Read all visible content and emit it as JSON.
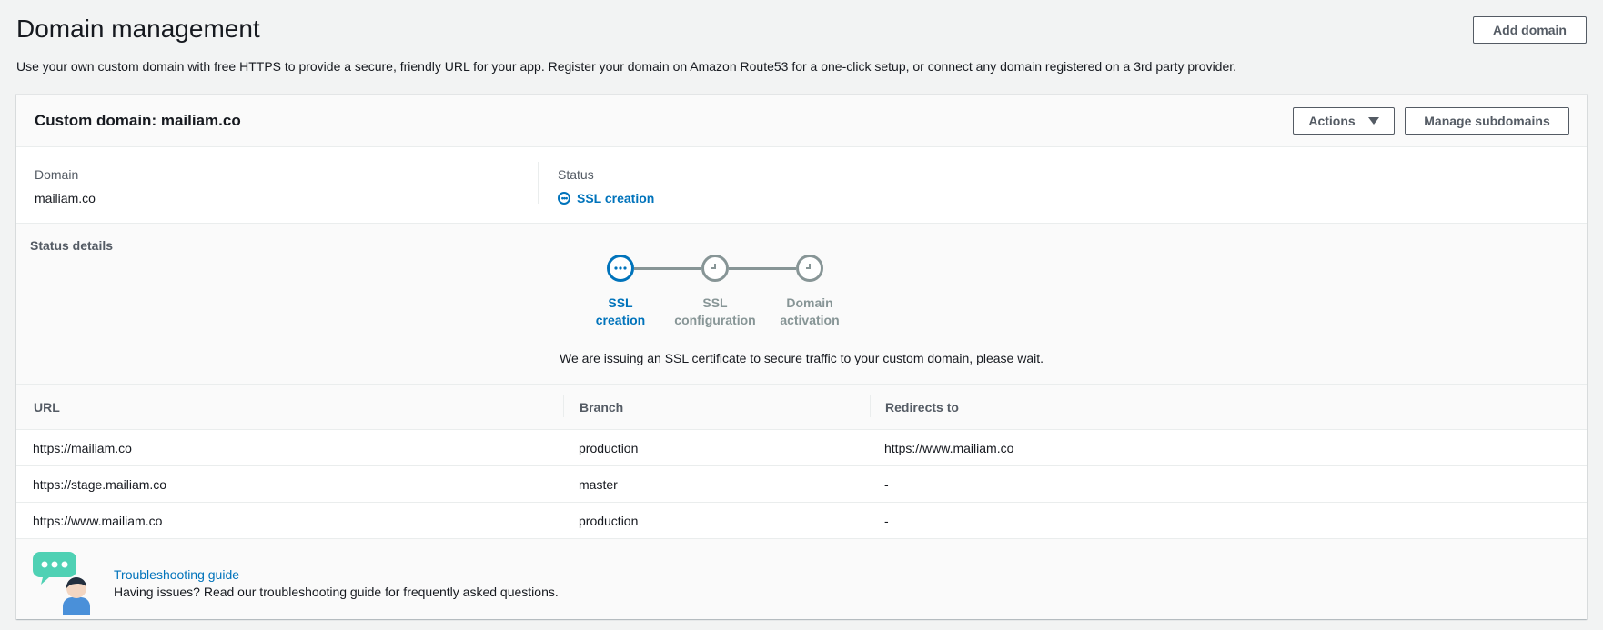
{
  "page": {
    "title": "Domain management",
    "description": "Use your own custom domain with free HTTPS to provide a secure, friendly URL for your app. Register your domain on Amazon Route53 for a one-click setup, or connect any domain registered on a 3rd party provider.",
    "add_domain_label": "Add domain"
  },
  "panel": {
    "title": "Custom domain: mailiam.co",
    "actions_label": "Actions",
    "manage_subdomains_label": "Manage subdomains",
    "domain_label": "Domain",
    "domain_value": "mailiam.co",
    "status_label": "Status",
    "status_value": "SSL creation"
  },
  "status_details": {
    "heading": "Status details",
    "steps": [
      {
        "line1": "SSL",
        "line2": "creation",
        "state": "active"
      },
      {
        "line1": "SSL",
        "line2": "configuration",
        "state": "pending"
      },
      {
        "line1": "Domain",
        "line2": "activation",
        "state": "pending"
      }
    ],
    "message": "We are issuing an SSL certificate to secure traffic to your custom domain, please wait."
  },
  "table": {
    "columns": [
      "URL",
      "Branch",
      "Redirects to"
    ],
    "rows": [
      [
        "https://mailiam.co",
        "production",
        "https://www.mailiam.co"
      ],
      [
        "https://stage.mailiam.co",
        "master",
        "-"
      ],
      [
        "https://www.mailiam.co",
        "production",
        "-"
      ]
    ]
  },
  "footer": {
    "link_label": "Troubleshooting guide",
    "text": "Having issues? Read our troubleshooting guide for frequently asked questions."
  },
  "colors": {
    "accent": "#0073bb",
    "pending": "#879596",
    "illustration_bubble": "#4fd1b4",
    "illustration_person": "#4a90d9"
  }
}
